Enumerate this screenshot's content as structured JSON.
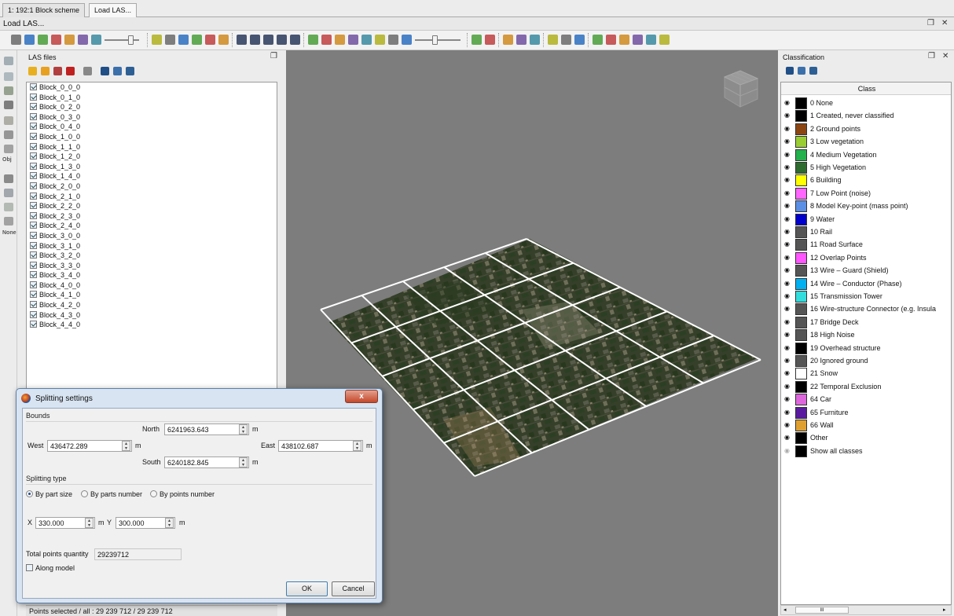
{
  "tabs": [
    {
      "label": "1: 192:1 Block scheme"
    },
    {
      "label": "Load LAS..."
    }
  ],
  "window": {
    "title": "Load LAS...",
    "float_icon": "float-icon",
    "close_icon": "close-icon"
  },
  "toolbar": {
    "icons": [
      "hand-pan-icon",
      "rotate-icon",
      "zoom-box-icon",
      "zoom-icon",
      "zoom-fit-icon",
      "zoom-magnify-icon",
      "eye-view-icon",
      "add-point-icon",
      "stack-icon",
      "square-icon",
      "shape-icon",
      "undo-icon",
      "redo-icon",
      "cube-view-icon",
      "cube-front-icon",
      "cube-side-icon",
      "cube-top-icon",
      "cube-iso-icon",
      "terrain-icon",
      "terrain-alt-icon",
      "rgb-icon",
      "nir-icon",
      "layers-icon",
      "elevation-icon",
      "intensity-icon",
      "classes-icon",
      "brightness-icon",
      "tools-icon",
      "grid-icon",
      "columns-icon",
      "image-icon",
      "box-icon",
      "camera-icon",
      "filter-icon",
      "palette-icon",
      "points-icon",
      "dots-icon",
      "chart-icon",
      "histogram-icon",
      "save-icon"
    ]
  },
  "left_tools": {
    "icons": [
      "ground-icon",
      "points-icon",
      "tree-icon",
      "building-icon",
      "terrain-icon",
      "house-icon",
      "document-icon",
      "road-icon",
      "car-icon",
      "wire-icon",
      "tower-icon"
    ],
    "obj_label": "Obj",
    "none_label": "None"
  },
  "las_panel": {
    "title": "LAS files",
    "toolbar_icons": [
      "open-folder-icon",
      "open-file-icon",
      "remove-icon",
      "remove-all-icon",
      "save-icon",
      "check-all-icon",
      "uncheck-icon",
      "invert-icon"
    ],
    "files": [
      "Block_0_0_0",
      "Block_0_1_0",
      "Block_0_2_0",
      "Block_0_3_0",
      "Block_0_4_0",
      "Block_1_0_0",
      "Block_1_1_0",
      "Block_1_2_0",
      "Block_1_3_0",
      "Block_1_4_0",
      "Block_2_0_0",
      "Block_2_1_0",
      "Block_2_2_0",
      "Block_2_3_0",
      "Block_2_4_0",
      "Block_3_0_0",
      "Block_3_1_0",
      "Block_3_2_0",
      "Block_3_3_0",
      "Block_3_4_0",
      "Block_4_0_0",
      "Block_4_1_0",
      "Block_4_2_0",
      "Block_4_3_0",
      "Block_4_4_0"
    ],
    "status": "Points selected / all : 29 239 712 / 29 239 712"
  },
  "classification": {
    "title": "Classification",
    "column_header": "Class",
    "rows": [
      {
        "label": "0 None",
        "color": "#000000"
      },
      {
        "label": "1 Created, never classified",
        "color": "#000000"
      },
      {
        "label": "2 Ground points",
        "color": "#8b4513"
      },
      {
        "label": "3 Low vegetation",
        "color": "#9acd32"
      },
      {
        "label": "4 Medium Vegetation",
        "color": "#22b14c"
      },
      {
        "label": "5 High Vegetation",
        "color": "#2e6b2e"
      },
      {
        "label": "6 Building",
        "color": "#ffff00"
      },
      {
        "label": "7 Low Point (noise)",
        "color": "#ff66ff"
      },
      {
        "label": "8 Model Key-point (mass point)",
        "color": "#5b8fe6"
      },
      {
        "label": "9 Water",
        "color": "#0000cc"
      },
      {
        "label": "10 Rail",
        "color": "#555555"
      },
      {
        "label": "11 Road Surface",
        "color": "#555555"
      },
      {
        "label": "12 Overlap Points",
        "color": "#ff55ff"
      },
      {
        "label": "13 Wire – Guard (Shield)",
        "color": "#555555"
      },
      {
        "label": "14 Wire – Conductor (Phase)",
        "color": "#00b0f0"
      },
      {
        "label": "15 Transmission Tower",
        "color": "#33dddd"
      },
      {
        "label": "16 Wire-structure Connector (e.g. Insula",
        "color": "#555555"
      },
      {
        "label": "17 Bridge Deck",
        "color": "#555555"
      },
      {
        "label": "18 High Noise",
        "color": "#555555"
      },
      {
        "label": "19 Overhead structure",
        "color": "#000000"
      },
      {
        "label": "20 Ignored ground",
        "color": "#555555"
      },
      {
        "label": "21 Snow",
        "color": "#ffffff"
      },
      {
        "label": "22 Temporal Exclusion",
        "color": "#000000"
      },
      {
        "label": "64 Car",
        "color": "#dd66dd"
      },
      {
        "label": "65 Furniture",
        "color": "#5a1aa0"
      },
      {
        "label": "66 Wall",
        "color": "#e0a030"
      },
      {
        "label": "Other",
        "color": "#000000"
      },
      {
        "label": "Show all classes",
        "color": "#000000"
      }
    ],
    "scrollbar_mid": "III"
  },
  "splitting_dialog": {
    "title": "Splitting settings",
    "bounds_label": "Bounds",
    "north_label": "North",
    "north_value": "6241963.643",
    "west_label": "West",
    "west_value": "436472.289",
    "east_label": "East",
    "east_value": "438102.687",
    "south_label": "South",
    "south_value": "6240182.845",
    "unit": "m",
    "splitting_type_label": "Splitting type",
    "options": [
      "By part size",
      "By parts number",
      "By points number"
    ],
    "selected_option": "By part size",
    "x_label": "X",
    "x_value": "330.000",
    "y_label": "Y",
    "y_value": "300.000",
    "total_points_label": "Total points quantity",
    "total_points_value": "29239712",
    "along_model_label": "Along model",
    "ok_label": "OK",
    "cancel_label": "Cancel",
    "close_label": "x"
  },
  "colors": {
    "viewport_bg": "#7d7d7d",
    "grid_line": "#ffffff",
    "dialog_frame": "#d8e4f2"
  }
}
